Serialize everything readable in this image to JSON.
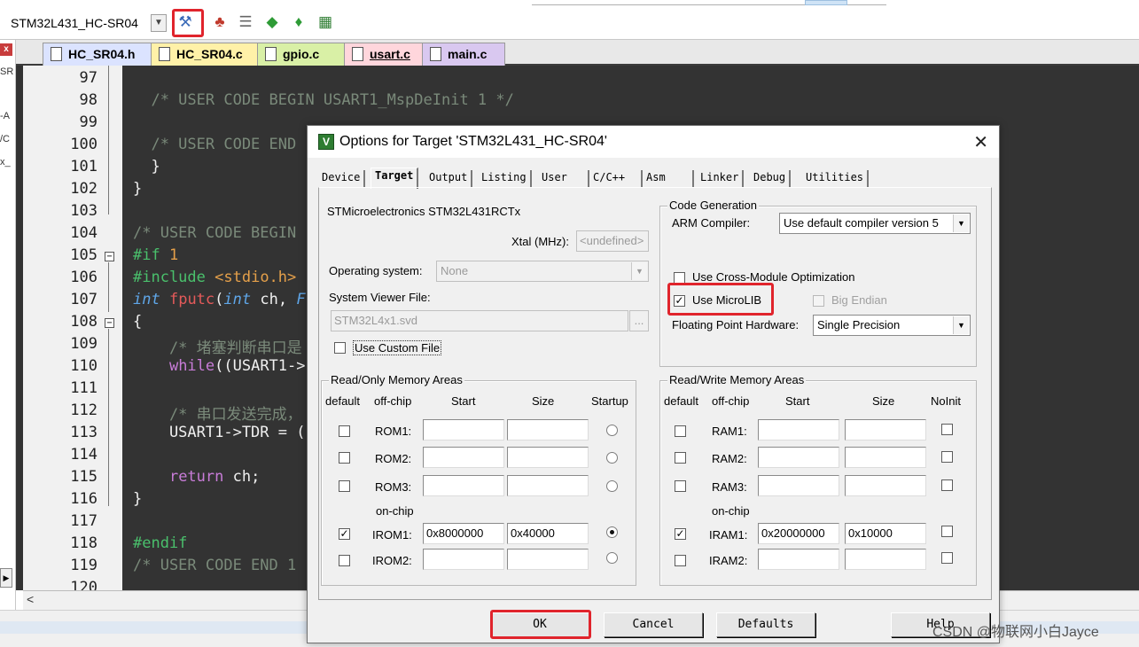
{
  "toolbar": {
    "target": "STM32L431_HC-SR04",
    "icons": [
      "magic-wand-icon",
      "manage-components-icon",
      "stack-icon",
      "green-diamond-icon",
      "download-icon",
      "pack-installer-icon"
    ]
  },
  "leftstrip": {
    "texts": [
      "SR",
      "-A",
      "/C",
      "x_"
    ]
  },
  "tabs": [
    {
      "label": "HC_SR04.h",
      "color": "#dbe3ff"
    },
    {
      "label": "HC_SR04.c",
      "color": "#fff1a8"
    },
    {
      "label": "gpio.c",
      "color": "#d9f0a6"
    },
    {
      "label": "usart.c",
      "color": "#ffd6dc"
    },
    {
      "label": "main.c",
      "color": "#d9c8f0"
    }
  ],
  "editor": {
    "line_numbers": [
      "97",
      "98",
      "99",
      "100",
      "101",
      "102",
      "103",
      "104",
      "105",
      "106",
      "107",
      "108",
      "109",
      "110",
      "111",
      "112",
      "113",
      "114",
      "115",
      "116",
      "117",
      "118",
      "119",
      "120"
    ]
  },
  "dialog": {
    "title": "Options for Target 'STM32L431_HC-SR04'",
    "close": "✕",
    "tabs": [
      "Device",
      "Target",
      "Output",
      "Listing",
      "User",
      "C/C++",
      "Asm",
      "Linker",
      "Debug",
      "Utilities"
    ],
    "device_name": "STMicroelectronics STM32L431RCTx",
    "xtal_label": "Xtal (MHz):",
    "xtal_value": "<undefined>",
    "os_label": "Operating system:",
    "os_value": "None",
    "svf_label": "System Viewer File:",
    "svf_value": "STM32L4x1.svd",
    "browse": "...",
    "custom_file": "Use Custom File",
    "codegen": {
      "title": "Code Generation",
      "arm_compiler_label": "ARM Compiler:",
      "arm_compiler_value": "Use default compiler version 5",
      "cross_module": "Use Cross-Module Optimization",
      "microlib": "Use MicroLIB",
      "big_endian": "Big Endian",
      "fph_label": "Floating Point Hardware:",
      "fph_value": "Single Precision"
    },
    "rom": {
      "title": "Read/Only Memory Areas",
      "headers": [
        "default",
        "off-chip",
        "Start",
        "Size",
        "Startup"
      ],
      "onchip": "on-chip",
      "rows": [
        {
          "label": "ROM1:",
          "start": "",
          "size": ""
        },
        {
          "label": "ROM2:",
          "start": "",
          "size": ""
        },
        {
          "label": "ROM3:",
          "start": "",
          "size": ""
        },
        {
          "label": "IROM1:",
          "start": "0x8000000",
          "size": "0x40000"
        },
        {
          "label": "IROM2:",
          "start": "",
          "size": ""
        }
      ]
    },
    "ram": {
      "title": "Read/Write Memory Areas",
      "headers": [
        "default",
        "off-chip",
        "Start",
        "Size",
        "NoInit"
      ],
      "onchip": "on-chip",
      "rows": [
        {
          "label": "RAM1:",
          "start": "",
          "size": ""
        },
        {
          "label": "RAM2:",
          "start": "",
          "size": ""
        },
        {
          "label": "RAM3:",
          "start": "",
          "size": ""
        },
        {
          "label": "IRAM1:",
          "start": "0x20000000",
          "size": "0x10000"
        },
        {
          "label": "IRAM2:",
          "start": "",
          "size": ""
        }
      ]
    },
    "buttons": {
      "ok": "OK",
      "cancel": "Cancel",
      "defaults": "Defaults",
      "help": "Help"
    }
  },
  "watermark": "CSDN @物联网小白Jayce",
  "highlight_color": "#e0242c"
}
